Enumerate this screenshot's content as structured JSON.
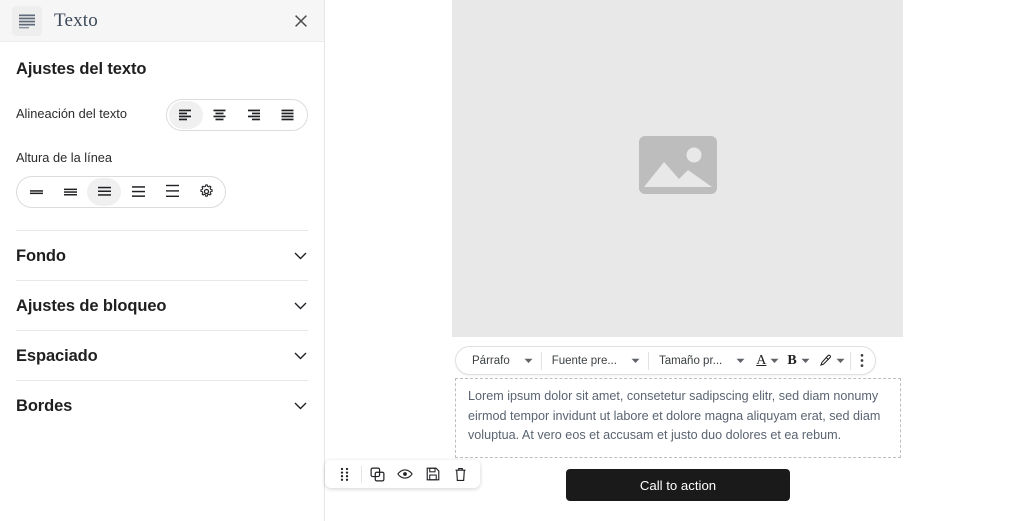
{
  "sidebar": {
    "header": {
      "icon": "text-lines-icon",
      "title": "Texto",
      "close_icon": "close-icon"
    },
    "section_heading": "Ajustes del texto",
    "fields": [
      {
        "label": "Alineación del texto",
        "type": "button-group",
        "selected_index": 0,
        "options": [
          {
            "name": "align-left-icon",
            "label": "Alinear a la izquierda"
          },
          {
            "name": "align-center-icon",
            "label": "Centrar"
          },
          {
            "name": "align-right-icon",
            "label": "Alinear a la derecha"
          },
          {
            "name": "align-justify-icon",
            "label": "Justificar"
          }
        ]
      },
      {
        "label": "Altura de la línea",
        "type": "button-group",
        "selected_index": 2,
        "options": [
          {
            "name": "line-height-1-icon",
            "label": "Altura 1"
          },
          {
            "name": "line-height-2-icon",
            "label": "Altura 2"
          },
          {
            "name": "line-height-3-icon",
            "label": "Altura 3"
          },
          {
            "name": "line-height-4-icon",
            "label": "Altura 4"
          },
          {
            "name": "line-height-5-icon",
            "label": "Altura 5"
          },
          {
            "name": "settings-gear-icon",
            "label": "Ajustes"
          }
        ]
      }
    ],
    "accordions": [
      {
        "label": "Fondo",
        "expanded": false,
        "icon": "chevron-down-icon"
      },
      {
        "label": "Ajustes de bloqueo",
        "expanded": false,
        "icon": "chevron-down-icon"
      },
      {
        "label": "Espaciado",
        "expanded": false,
        "icon": "chevron-down-icon"
      },
      {
        "label": "Bordes",
        "expanded": false,
        "icon": "chevron-down-icon"
      }
    ]
  },
  "canvas": {
    "image_placeholder": {
      "icon": "image-placeholder-icon",
      "background_color": "#e8e8e8"
    },
    "editor_toolbar": {
      "paragraph_style": "Párrafo",
      "font_family": "Fuente pre...",
      "font_size": "Tamaño pr...",
      "text_color_glyph": "A",
      "bold_glyph": "B",
      "highlight_icon": "highlighter-pen-icon",
      "more_icon": "more-vertical-icon",
      "caret_icon": "caret-down-icon"
    },
    "text_block": {
      "content": "Lorem ipsum dolor sit amet, consetetur sadipscing elitr, sed diam nonumy eirmod tempor invidunt ut labore et dolore magna aliquyam erat, sed diam voluptua. At vero eos et accusam et justo duo dolores et ea rebum."
    },
    "block_toolbar": {
      "items": [
        {
          "name": "drag-handle-icon",
          "label": "Mover"
        },
        {
          "name": "duplicate-icon",
          "label": "Duplicar"
        },
        {
          "name": "eye-icon",
          "label": "Vista previa"
        },
        {
          "name": "save-icon",
          "label": "Guardar"
        },
        {
          "name": "trash-icon",
          "label": "Eliminar"
        }
      ]
    },
    "cta_bar": {
      "label": "Call to action",
      "background_color": "#1a1a1a",
      "text_color": "#ffffff"
    }
  }
}
